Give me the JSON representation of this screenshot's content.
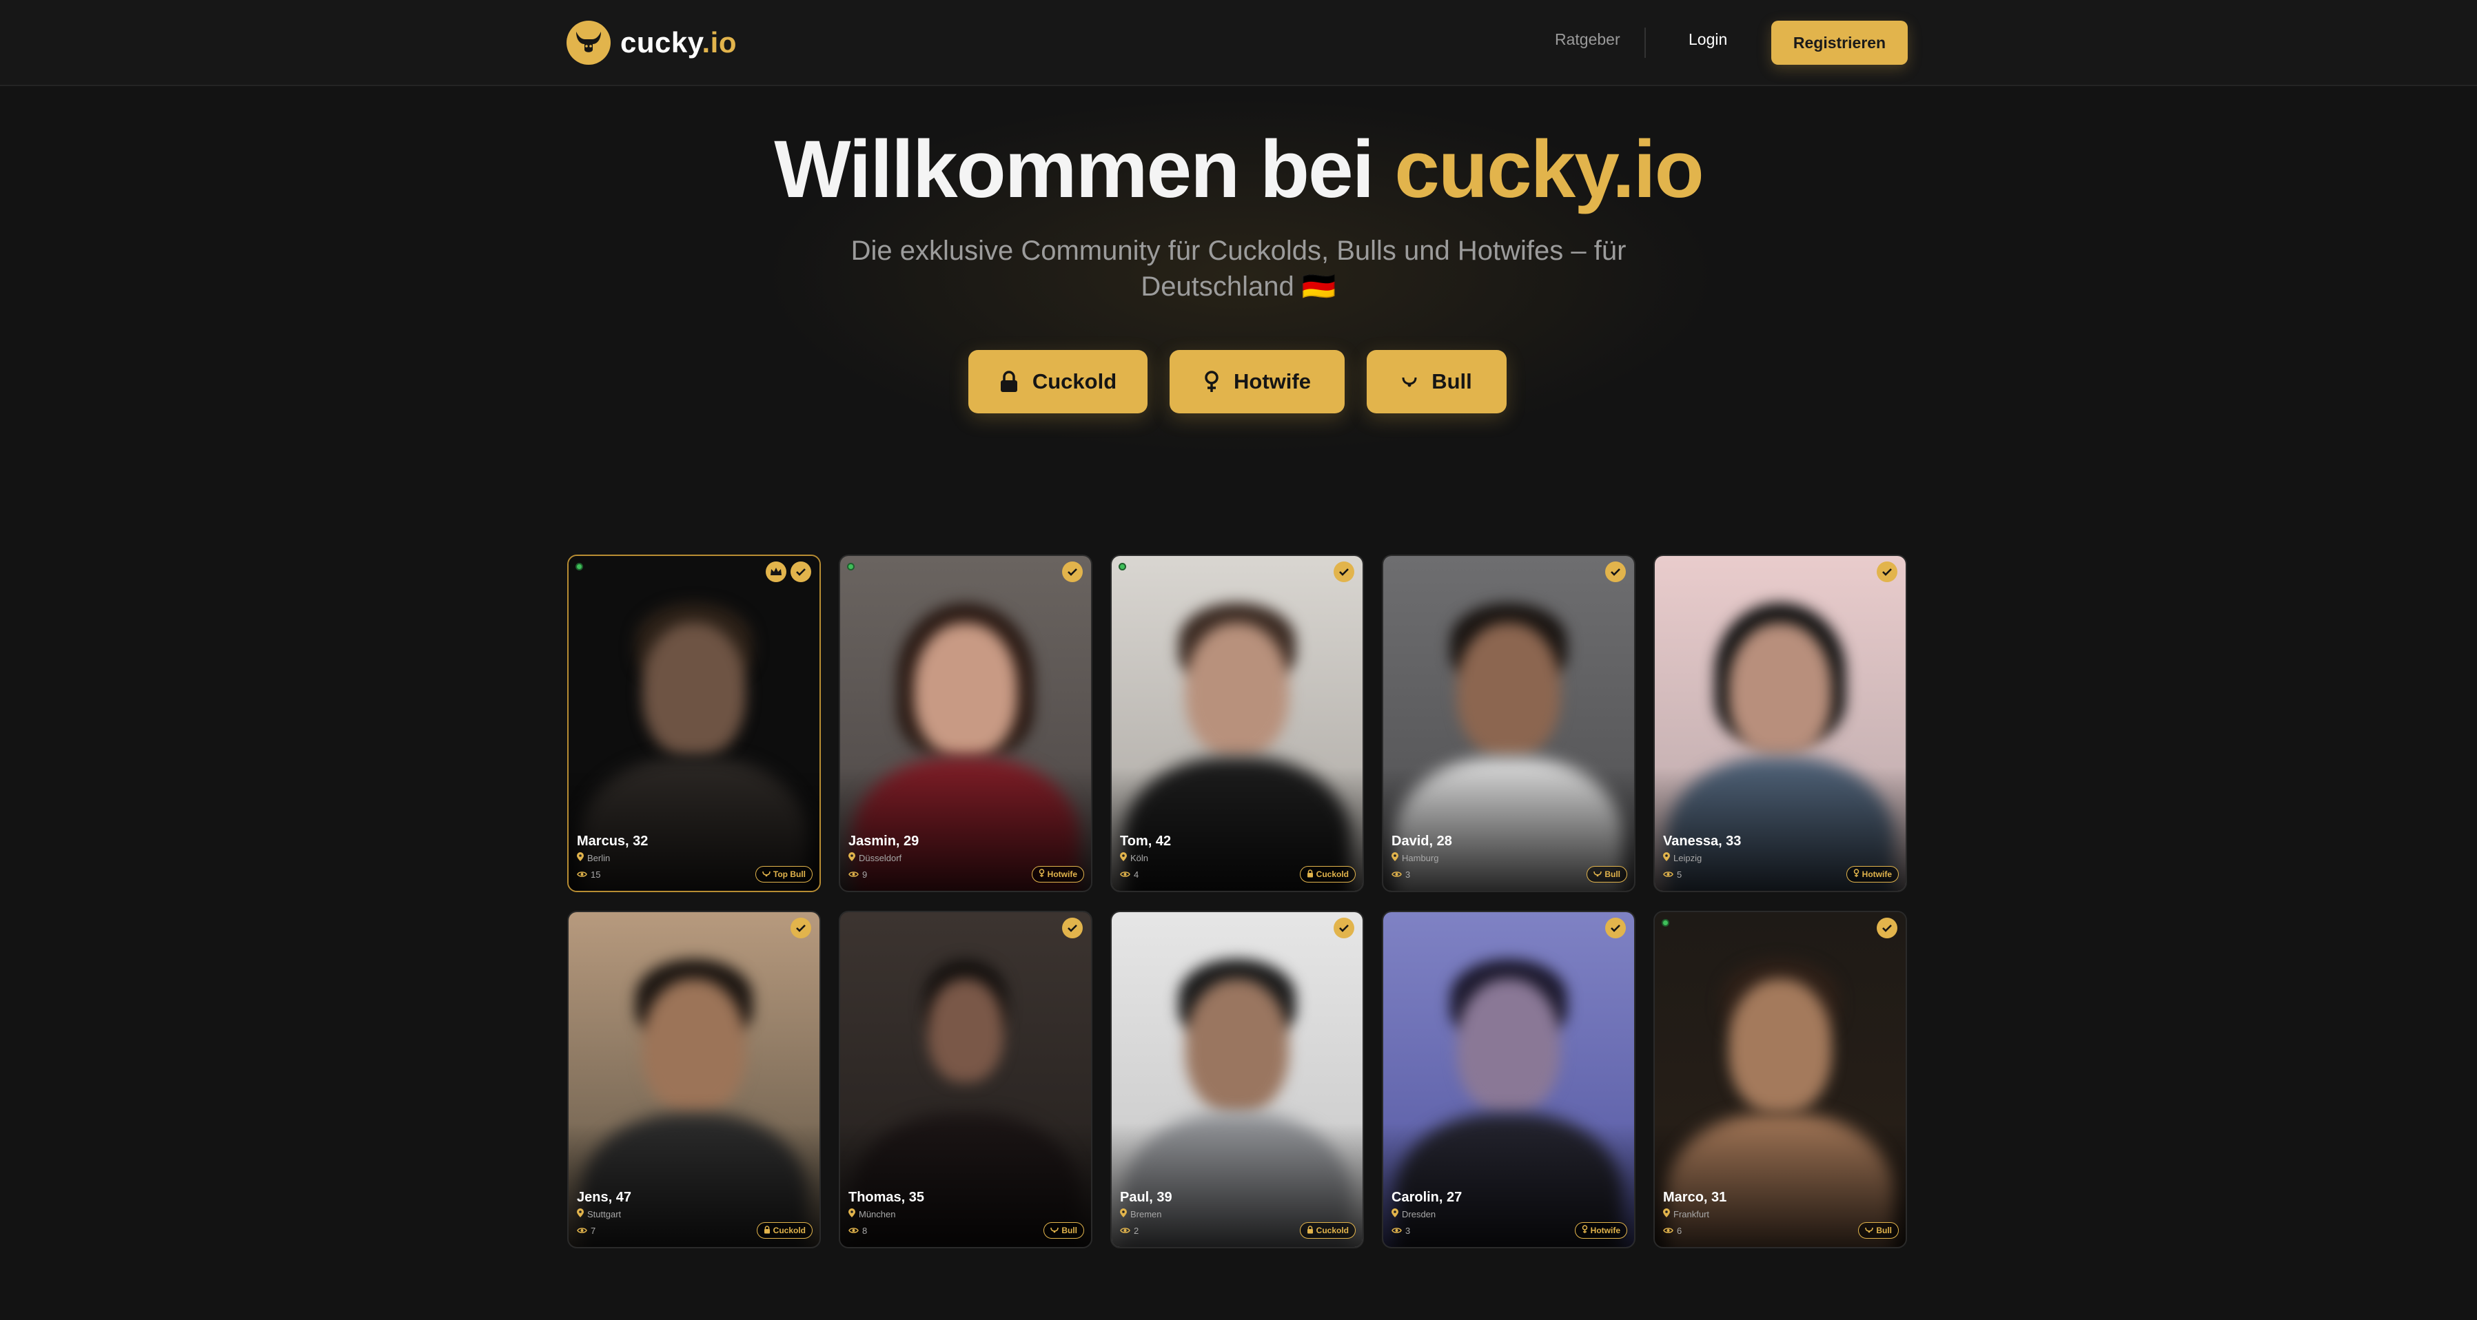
{
  "header": {
    "brand": "cucky",
    "tld": ".io",
    "nav_guide": "Ratgeber",
    "login": "Login",
    "register": "Registrieren"
  },
  "hero": {
    "title_prefix": "Willkommen bei",
    "title_accent": "cucky.io",
    "subtitle_line1": "Die exklusive Community für Cuckolds, Bulls und Hotwifes – für",
    "subtitle_line2": "Deutschland 🇩🇪",
    "buttons": {
      "cuckold": "Cuckold",
      "hotwife": "Hotwife",
      "bull": "Bull"
    }
  },
  "colors": {
    "accent": "#e2b44c",
    "background": "#131313",
    "header": "#171717",
    "online": "#3fbf5a"
  },
  "profiles": [
    {
      "name": "Marcus, 32",
      "city": "Berlin",
      "views": "15",
      "role": "Top Bull",
      "role_icon": "bull-icon",
      "online": true,
      "verified": true,
      "premium": true
    },
    {
      "name": "Jasmin, 29",
      "city": "Düsseldorf",
      "views": "9",
      "role": "Hotwife",
      "role_icon": "venus-icon",
      "online": true,
      "verified": true,
      "premium": false
    },
    {
      "name": "Tom, 42",
      "city": "Köln",
      "views": "4",
      "role": "Cuckold",
      "role_icon": "lock-icon",
      "online": true,
      "verified": true,
      "premium": false
    },
    {
      "name": "David, 28",
      "city": "Hamburg",
      "views": "3",
      "role": "Bull",
      "role_icon": "bull-icon",
      "online": false,
      "verified": true,
      "premium": false
    },
    {
      "name": "Vanessa, 33",
      "city": "Leipzig",
      "views": "5",
      "role": "Hotwife",
      "role_icon": "venus-icon",
      "online": false,
      "verified": true,
      "premium": false
    },
    {
      "name": "Jens, 47",
      "city": "Stuttgart",
      "views": "7",
      "role": "Cuckold",
      "role_icon": "lock-icon",
      "online": false,
      "verified": true,
      "premium": false
    },
    {
      "name": "Thomas, 35",
      "city": "München",
      "views": "8",
      "role": "Bull",
      "role_icon": "bull-icon",
      "online": false,
      "verified": true,
      "premium": false
    },
    {
      "name": "Paul, 39",
      "city": "Bremen",
      "views": "2",
      "role": "Cuckold",
      "role_icon": "lock-icon",
      "online": false,
      "verified": true,
      "premium": false
    },
    {
      "name": "Carolin, 27",
      "city": "Dresden",
      "views": "3",
      "role": "Hotwife",
      "role_icon": "venus-icon",
      "online": false,
      "verified": true,
      "premium": false
    },
    {
      "name": "Marco, 31",
      "city": "Frankfurt",
      "views": "6",
      "role": "Bull",
      "role_icon": "bull-icon",
      "online": true,
      "verified": true,
      "premium": false
    }
  ]
}
